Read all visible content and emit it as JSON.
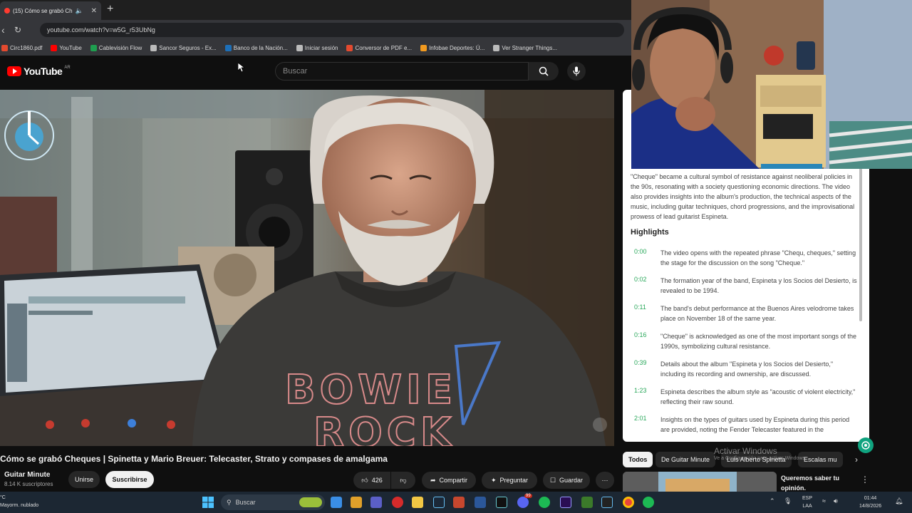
{
  "browser": {
    "tab_title": "(15) Cómo se grabó Ch",
    "url": "youtube.com/watch?v=w5G_r53UbNg",
    "bookmarks": [
      {
        "label": "Circ1860.pdf",
        "color": "#e34a2f"
      },
      {
        "label": "YouTube",
        "color": "#ff0000"
      },
      {
        "label": "Cablevisión Flow",
        "color": "#1e9e4f"
      },
      {
        "label": "Sancor Seguros - Ex...",
        "color": "#bbbbbb"
      },
      {
        "label": "Banco de la Nación...",
        "color": "#1d6fb8"
      },
      {
        "label": "Iniciar sesión",
        "color": "#bbbbbb"
      },
      {
        "label": "Conversor de PDF e...",
        "color": "#e34a2f"
      },
      {
        "label": "Infobae Deportes: Ú...",
        "color": "#f29a1f"
      },
      {
        "label": "Ver Stranger Things...",
        "color": "#bbbbbb"
      }
    ]
  },
  "youtube": {
    "logo_text": "YouTube",
    "logo_region": "AR",
    "search_placeholder": "Buscar"
  },
  "video": {
    "title": "Cómo se grabó Cheques | Spinetta y Mario Breuer: Telecaster, Strato y compases de amalgama",
    "channel_name": "Guitar Minute",
    "subscribers": "8.14 K suscriptores",
    "join_label": "Unirse",
    "subscribe_label": "Suscribirse",
    "likes": "426",
    "share_label": "Compartir",
    "ask_label": "Preguntar",
    "save_label": "Guardar",
    "shirt_text_top": "BOWIE",
    "shirt_text_bottom": "ROCK"
  },
  "summary": {
    "intro": "\"Cheque\" became a cultural symbol of resistance against neoliberal policies in the 90s, resonating with a society questioning economic directions. The video also provides insights into the album's production, the technical aspects of the music, including guitar techniques, chord progressions, and the improvisational prowess of lead guitarist Espineta.",
    "highlights_title": "Highlights",
    "highlights": [
      {
        "time": "0:00",
        "text": "The video opens with the repeated phrase \"Chequ, cheques,\" setting the stage for the discussion on the song \"Cheque.\""
      },
      {
        "time": "0:02",
        "text": "The formation year of the band, Espineta y los Socios del Desierto, is revealed to be 1994."
      },
      {
        "time": "0:11",
        "text": "The band's debut performance at the Buenos Aires velodrome takes place on November 18 of the same year."
      },
      {
        "time": "0:16",
        "text": "\"Cheque\" is acknowledged as one of the most important songs of the 1990s, symbolizing cultural resistance."
      },
      {
        "time": "0:39",
        "text": "Details about the album \"Espineta y los Socios del Desierto,\" including its recording and ownership, are discussed."
      },
      {
        "time": "1:23",
        "text": "Espineta describes the album style as \"acoustic of violent electricity,\" reflecting their raw sound."
      },
      {
        "time": "2:01",
        "text": "Insights on the types of guitars used by Espineta during this period are provided, noting the Fender Telecaster featured in the"
      }
    ]
  },
  "chips": [
    "Todos",
    "De Guitar Minute",
    "Luis Alberto Spinetta",
    "Escalas mu"
  ],
  "watermark": {
    "title": "Activar Windows",
    "subtitle": "Ve a Configuración para activar Windows."
  },
  "recommended_title": "Queremos saber tu opinión.",
  "taskbar": {
    "weather_line1": "°C",
    "weather_line2": "Mayorm. nublado",
    "search_label": "Buscar",
    "lang_line1": "ESP",
    "lang_line2": "LAA",
    "time": "01:44",
    "date": "14/8/2026",
    "notification_badge": "99"
  }
}
